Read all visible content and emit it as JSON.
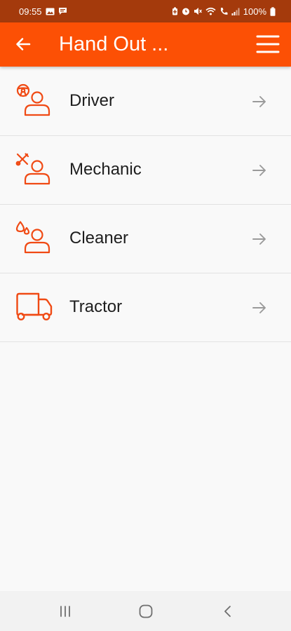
{
  "status_bar": {
    "time": "09:55",
    "battery": "100%",
    "left_icons": [
      "gallery-icon",
      "message-icon"
    ],
    "right_icons": [
      "battery-saver-icon",
      "alarm-icon",
      "mute-icon",
      "wifi-icon",
      "call-icon",
      "signal-icon",
      "battery-icon"
    ]
  },
  "app_bar": {
    "title": "Hand Out ...",
    "back_icon": "back-arrow-icon",
    "menu_icon": "hamburger-menu-icon"
  },
  "list": {
    "items": [
      {
        "label": "Driver",
        "icon": "driver-icon"
      },
      {
        "label": "Mechanic",
        "icon": "mechanic-icon"
      },
      {
        "label": "Cleaner",
        "icon": "cleaner-icon"
      },
      {
        "label": "Tractor",
        "icon": "tractor-icon"
      }
    ],
    "arrow_icon": "arrow-right-icon"
  },
  "nav_bar": {
    "icons": [
      "recent-apps-icon",
      "home-icon",
      "nav-back-icon"
    ]
  },
  "colors": {
    "accent": "#fc5005",
    "status_bar": "#a43a0c",
    "icon": "#f04a14",
    "arrow": "#9a9a9a",
    "text": "#1e1e1e",
    "background": "#f9f9f9",
    "divider": "#e2e2e2"
  }
}
